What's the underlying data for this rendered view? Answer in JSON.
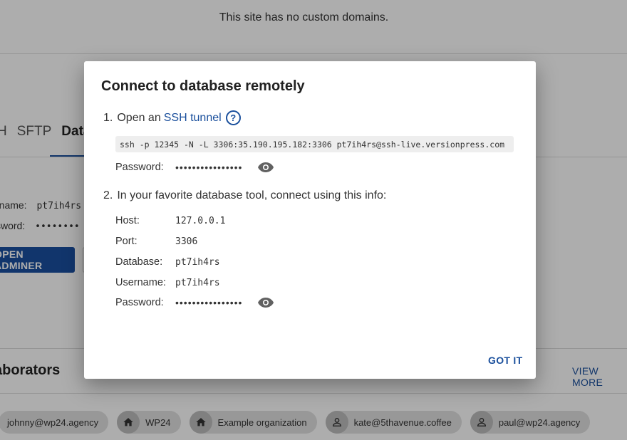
{
  "background": {
    "no_domains_text": "This site has no custom domains.",
    "tabs": [
      "H",
      "SFTP",
      "Data"
    ],
    "username_label": "rname:",
    "username_value": "pt7ih4rs",
    "password_label": "sword:",
    "password_dots": "••••••••",
    "adminer_button": "OPEN ADMINER",
    "collaborators_title": "aborators",
    "view_more": "VIEW MORE",
    "chips": [
      {
        "label": "johnny@wp24.agency",
        "icon": "none"
      },
      {
        "label": "WP24",
        "icon": "home-icon"
      },
      {
        "label": "Example organization",
        "icon": "home-icon"
      },
      {
        "label": "kate@5thavenue.coffee",
        "icon": "person-icon"
      },
      {
        "label": "paul@wp24.agency",
        "icon": "person-icon"
      }
    ]
  },
  "dialog": {
    "title": "Connect to database remotely",
    "step1": {
      "number": "1.",
      "text": "Open an",
      "link": "SSH tunnel",
      "help_icon": "?",
      "command": "ssh -p 12345 -N -L 3306:35.190.195.182:3306 pt7ih4rs@ssh-live.versionpress.com",
      "password_label": "Password:",
      "password_dots": "••••••••••••••••"
    },
    "step2": {
      "number": "2.",
      "text": "In your favorite database tool, connect using this info:",
      "fields": [
        {
          "label": "Host:",
          "value": "127.0.0.1"
        },
        {
          "label": "Port:",
          "value": "3306"
        },
        {
          "label": "Database:",
          "value": "pt7ih4rs"
        },
        {
          "label": "Username:",
          "value": "pt7ih4rs"
        }
      ],
      "password_label": "Password:",
      "password_dots": "••••••••••••••••"
    },
    "got_it": "GOT IT"
  },
  "colors": {
    "accent": "#1a4f9c",
    "overlay": "rgba(0,0,0,0.32)"
  }
}
